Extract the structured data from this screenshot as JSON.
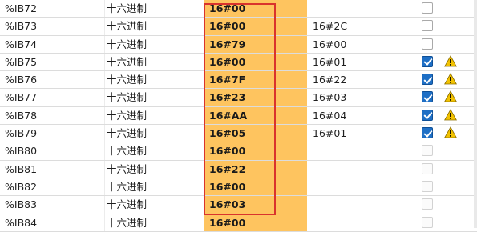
{
  "colors": {
    "monitor_bg": "#fec45f",
    "highlight_border": "#d9332d",
    "checkbox_on": "#1e6fc5",
    "warning": "#f2c200"
  },
  "rows": [
    {
      "addr": "%IB72",
      "fmt": "十六进制",
      "mon": "16#00",
      "mod": "",
      "chk": "off",
      "warn": false
    },
    {
      "addr": "%IB73",
      "fmt": "十六进制",
      "mon": "16#00",
      "mod": "16#2C",
      "chk": "off",
      "warn": false
    },
    {
      "addr": "%IB74",
      "fmt": "十六进制",
      "mon": "16#79",
      "mod": "16#00",
      "chk": "off",
      "warn": false
    },
    {
      "addr": "%IB75",
      "fmt": "十六进制",
      "mon": "16#00",
      "mod": "16#01",
      "chk": "on",
      "warn": true
    },
    {
      "addr": "%IB76",
      "fmt": "十六进制",
      "mon": "16#7F",
      "mod": "16#22",
      "chk": "on",
      "warn": true
    },
    {
      "addr": "%IB77",
      "fmt": "十六进制",
      "mon": "16#23",
      "mod": "16#03",
      "chk": "on",
      "warn": true
    },
    {
      "addr": "%IB78",
      "fmt": "十六进制",
      "mon": "16#AA",
      "mod": "16#04",
      "chk": "on",
      "warn": true
    },
    {
      "addr": "%IB79",
      "fmt": "十六进制",
      "mon": "16#05",
      "mod": "16#01",
      "chk": "on",
      "warn": true
    },
    {
      "addr": "%IB80",
      "fmt": "十六进制",
      "mon": "16#00",
      "mod": "",
      "chk": "dim",
      "warn": false
    },
    {
      "addr": "%IB81",
      "fmt": "十六进制",
      "mon": "16#22",
      "mod": "",
      "chk": "dim",
      "warn": false
    },
    {
      "addr": "%IB82",
      "fmt": "十六进制",
      "mon": "16#00",
      "mod": "",
      "chk": "dim",
      "warn": false
    },
    {
      "addr": "%IB83",
      "fmt": "十六进制",
      "mon": "16#03",
      "mod": "",
      "chk": "dim",
      "warn": false
    },
    {
      "addr": "%IB84",
      "fmt": "十六进制",
      "mon": "16#00",
      "mod": "",
      "chk": "dim",
      "warn": false
    }
  ]
}
